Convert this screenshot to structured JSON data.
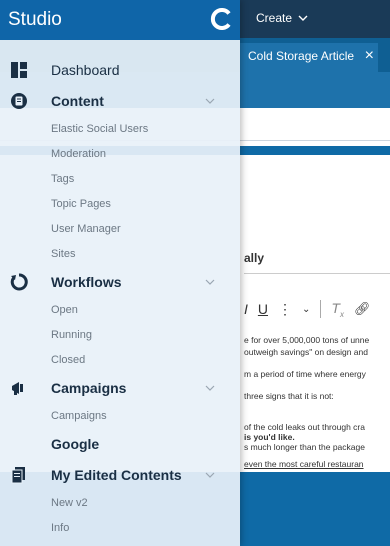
{
  "app": {
    "title": "Studio",
    "create_label": "Create"
  },
  "editor": {
    "tab_title": "Cold Storage Article",
    "field_label_partial": "ally",
    "body_lines": [
      "e for over 5,000,000 tons of unne",
      "outweigh savings\" on design and",
      "m a period of time where energy",
      "three signs that it is not:",
      "of the cold leaks out through cra",
      "is you'd like.",
      "s much longer than the package",
      "even the most careful restauran"
    ]
  },
  "sidebar": {
    "items": [
      {
        "kind": "main",
        "label": "Dashboard",
        "icon": "dashboard-icon",
        "expandable": false
      },
      {
        "kind": "main",
        "label": "Content",
        "icon": "content-icon",
        "expandable": true
      },
      {
        "kind": "sub",
        "label": "Elastic Social Users"
      },
      {
        "kind": "sub",
        "label": "Moderation"
      },
      {
        "kind": "sub",
        "label": "Tags"
      },
      {
        "kind": "sub",
        "label": "Topic Pages"
      },
      {
        "kind": "sub",
        "label": "User Manager"
      },
      {
        "kind": "sub",
        "label": "Sites"
      },
      {
        "kind": "main",
        "label": "Workflows",
        "icon": "workflows-icon",
        "expandable": true
      },
      {
        "kind": "sub",
        "label": "Open"
      },
      {
        "kind": "sub",
        "label": "Running"
      },
      {
        "kind": "sub",
        "label": "Closed"
      },
      {
        "kind": "main",
        "label": "Campaigns",
        "icon": "campaigns-icon",
        "expandable": true
      },
      {
        "kind": "sub",
        "label": "Campaigns"
      },
      {
        "kind": "main",
        "label": "Google",
        "icon": null,
        "expandable": false
      },
      {
        "kind": "main",
        "label": "My Edited Contents",
        "icon": "edited-contents-icon",
        "expandable": true
      },
      {
        "kind": "sub",
        "label": "New v2"
      },
      {
        "kind": "sub",
        "label": "Info"
      }
    ]
  },
  "colors": {
    "header_blue": "#0f65a8",
    "topbar_navy": "#1a3a57",
    "sidebar_bg": "#e8f1f9"
  }
}
